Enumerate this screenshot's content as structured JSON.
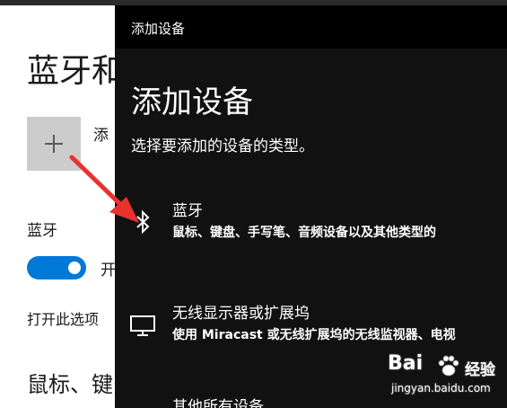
{
  "settings": {
    "title": "蓝牙和",
    "add_label": "添",
    "bluetooth_label": "蓝牙",
    "toggle_label": "开",
    "hint": "打开此选项",
    "section_heading": "鼠标、键"
  },
  "dialog": {
    "titlebar": "添加设备",
    "heading": "添加设备",
    "instruction": "选择要添加的设备的类型。",
    "options": [
      {
        "title": "蓝牙",
        "description": "鼠标、键盘、手写笔、音频设备以及其他类型的",
        "icon": "bluetooth-icon"
      },
      {
        "title": "无线显示器或扩展坞",
        "description": "使用 Miracast 或无线扩展坞的无线监视器、电视",
        "icon": "monitor-icon"
      },
      {
        "title": "其他所有设备",
        "description": "",
        "icon": "devices-icon"
      }
    ]
  },
  "watermark": {
    "logo": "Bai",
    "logo2": "经验",
    "url": "jingyan.baidu.com"
  },
  "colors": {
    "accent": "#0078d7",
    "dialog_bg": "#111111",
    "annotation_arrow": "#e8322e"
  }
}
